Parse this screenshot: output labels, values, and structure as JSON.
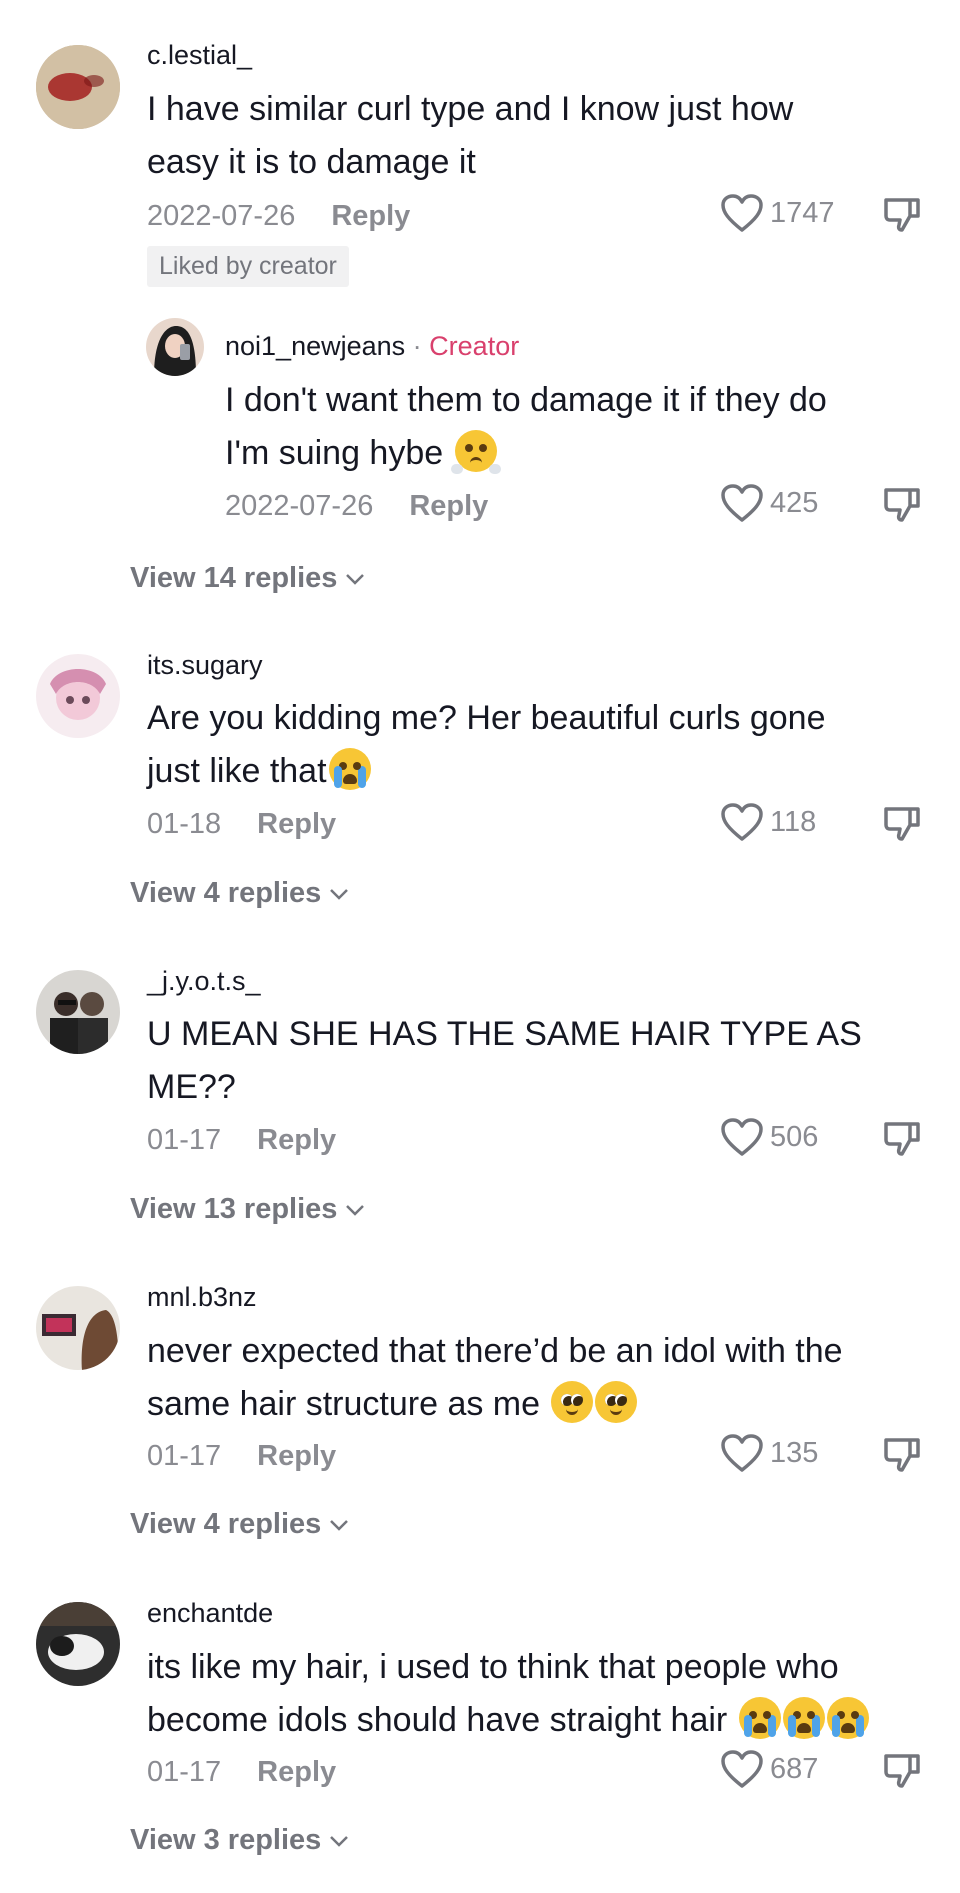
{
  "comments": [
    {
      "username": "c.lestial_",
      "text_lines": [
        "I have similar curl type and I know just how",
        "easy it is to damage it"
      ],
      "date": "2022-07-26",
      "reply_label": "Reply",
      "likes": "1747",
      "badge": "Liked by creator",
      "avatar_colors": [
        "#c9b59a",
        "#a31f1f"
      ],
      "reply": {
        "username": "noi1_newjeans",
        "separator": "·",
        "creator_label": "Creator",
        "text_lines": [
          "I don't want them to damage it if they do",
          "I'm suing hybe"
        ],
        "emoji": [
          "face-with-steam-from-nose"
        ],
        "date": "2022-07-26",
        "reply_label": "Reply",
        "likes": "425",
        "avatar_colors": [
          "#2b2b2b",
          "#e8d7cc"
        ]
      },
      "view_replies": "View 14 replies"
    },
    {
      "username": "its.sugary",
      "text_lines": [
        "Are you kidding me? Her beautiful curls gone",
        "just like that"
      ],
      "emoji": [
        "loudly-crying-face"
      ],
      "date": "01-18",
      "reply_label": "Reply",
      "likes": "118",
      "avatar_colors": [
        "#f3e3ea",
        "#d58fb0"
      ],
      "view_replies": "View 4 replies"
    },
    {
      "username": "_j.y.o.t.s_",
      "text_lines": [
        "U MEAN SHE HAS THE SAME HAIR TYPE AS",
        "ME??"
      ],
      "date": "01-17",
      "reply_label": "Reply",
      "likes": "506",
      "avatar_colors": [
        "#d8d6d2",
        "#2a2a2a"
      ],
      "view_replies": "View 13 replies"
    },
    {
      "username": "mnl.b3nz",
      "text_lines": [
        "never expected that there’d be an idol with the",
        "same hair structure as me"
      ],
      "emoji": [
        "pleading-face",
        "pleading-face"
      ],
      "date": "01-17",
      "reply_label": "Reply",
      "likes": "135",
      "avatar_colors": [
        "#e9e5df",
        "#c2335a"
      ],
      "view_replies": "View 4 replies"
    },
    {
      "username": "enchantde",
      "text_lines": [
        "its like my hair, i used to think that people who",
        "become idols should have straight hair"
      ],
      "emoji": [
        "loudly-crying-face",
        "loudly-crying-face",
        "loudly-crying-face"
      ],
      "date": "01-17",
      "reply_label": "Reply",
      "likes": "687",
      "avatar_colors": [
        "#3a3a3a",
        "#efefef"
      ],
      "view_replies": "View 3 replies"
    }
  ],
  "colors": {
    "text": "#161823",
    "secondary": "#8a8b91",
    "creator": "#d9406d",
    "badge_bg": "#f1f1f2"
  },
  "icons": [
    "heart-icon",
    "dislike-icon",
    "chevron-down-icon"
  ]
}
